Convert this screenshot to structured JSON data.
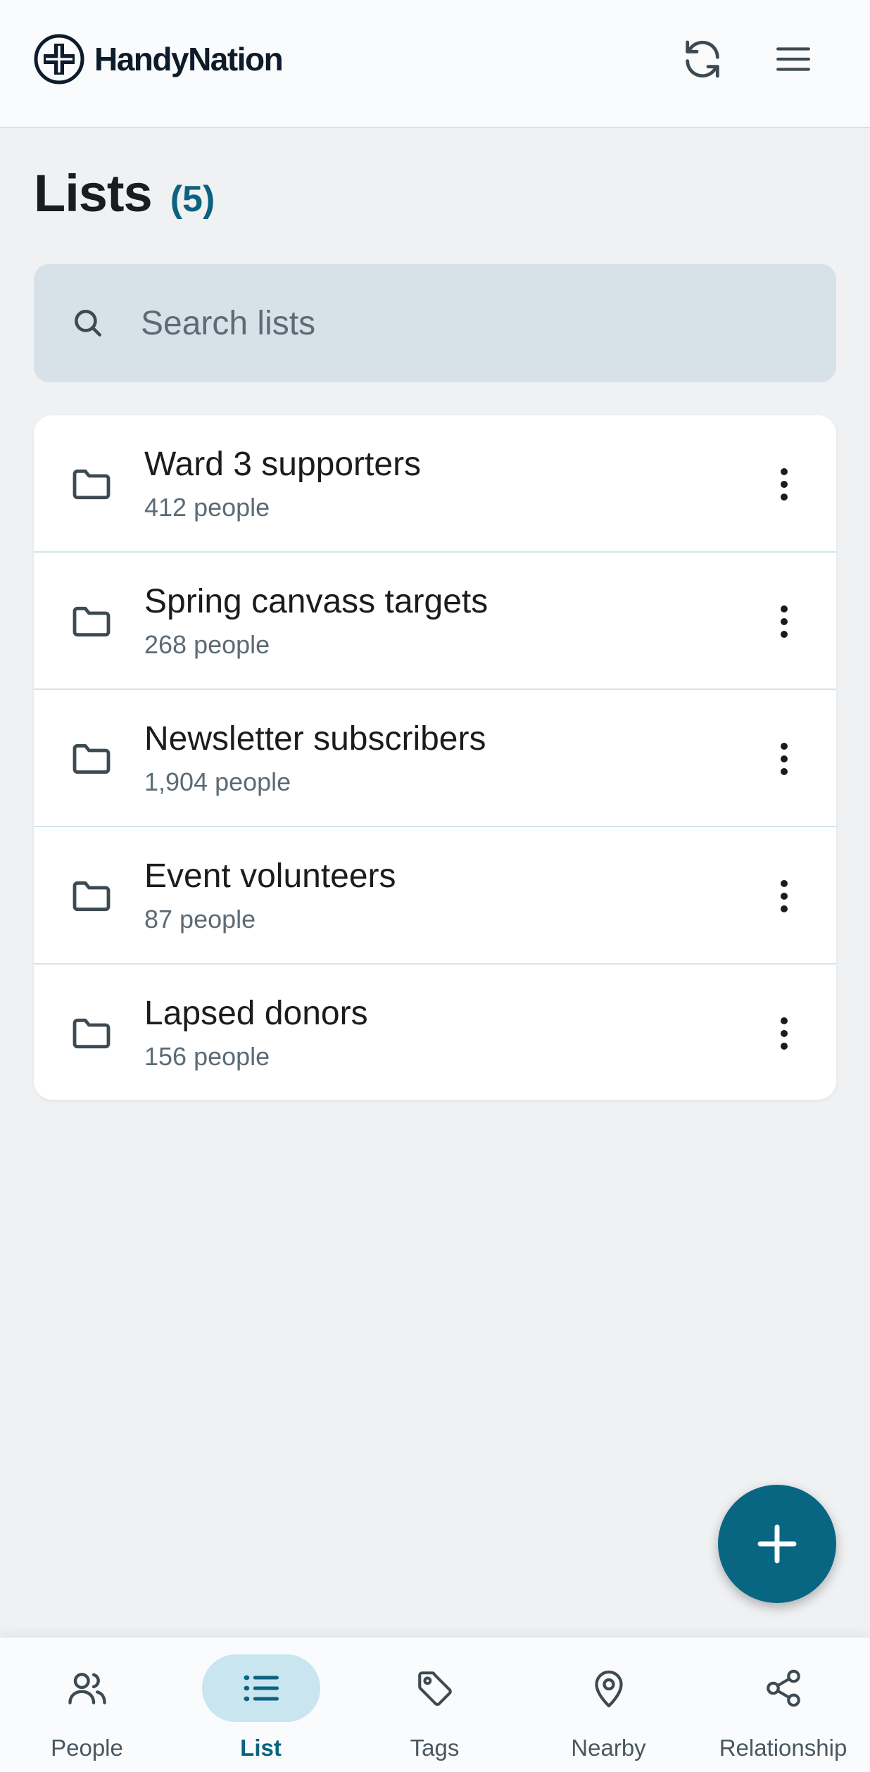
{
  "app": {
    "brand_name": "HandyNation",
    "logo_icon": "handynation-logo-icon",
    "refresh_icon": "sync-icon",
    "menu_icon": "hamburger-menu-icon"
  },
  "page": {
    "title": "Lists",
    "count": "(5)"
  },
  "search": {
    "placeholder": "Search lists",
    "value": ""
  },
  "lists": [
    {
      "name": "Ward 3 supporters",
      "meta": "412 people"
    },
    {
      "name": "Spring canvass targets",
      "meta": "268 people"
    },
    {
      "name": "Newsletter subscribers",
      "meta": "1,904 people"
    },
    {
      "name": "Event volunteers",
      "meta": "87 people"
    },
    {
      "name": "Lapsed donors",
      "meta": "156 people"
    }
  ],
  "fab": {
    "icon": "plus-icon"
  },
  "nav": {
    "active": "List",
    "items": [
      {
        "label": "People",
        "icon": "people-icon"
      },
      {
        "label": "List",
        "icon": "list-icon"
      },
      {
        "label": "Tags",
        "icon": "tag-icon"
      },
      {
        "label": "Nearby",
        "icon": "map-pin-icon"
      },
      {
        "label": "Relationship",
        "icon": "share-nodes-icon"
      }
    ]
  },
  "colors": {
    "accent": "#0b6381",
    "fab": "#086683",
    "background": "#eff1f3",
    "search_bg": "#d6e2e8",
    "nav_active_pill": "#c9e5f0"
  }
}
